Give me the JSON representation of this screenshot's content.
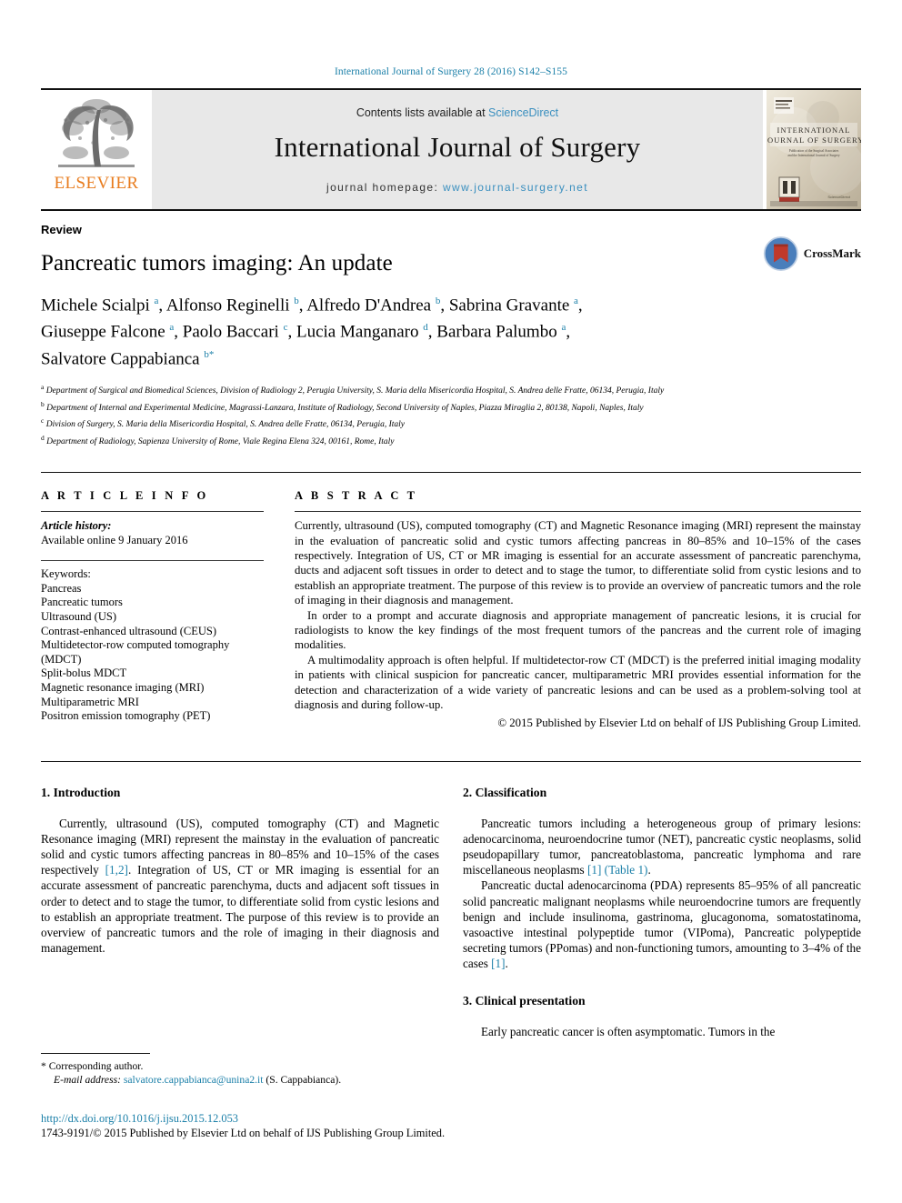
{
  "running_head": "International Journal of Surgery 28 (2016) S142–S155",
  "masthead": {
    "contents_prefix": "Contents lists available at ",
    "sciencedirect": "ScienceDirect",
    "journal_title": "International Journal of Surgery",
    "homepage_prefix": "journal homepage: ",
    "homepage_url": "www.journal-surgery.net",
    "publisher_name": "ELSEVIER",
    "cover_title_line1": "INTERNATIONAL",
    "cover_title_line2": "JOURNAL OF SURGERY"
  },
  "article": {
    "doctype": "Review",
    "title": "Pancreatic tumors imaging: An update",
    "authors_line1": "Michele Scialpi ",
    "authors_line1_sup1": "a",
    "authors_line1_b": ", Alfonso Reginelli ",
    "authors_line1_sup2": "b",
    "authors_line1_c": ", Alfredo D'Andrea ",
    "authors_line1_sup3": "b",
    "authors_line1_d": ", Sabrina Gravante ",
    "authors_line1_sup4": "a",
    "authors_line1_e": ",",
    "authors_line2_a": "Giuseppe Falcone ",
    "authors_line2_sup1": "a",
    "authors_line2_b": ", Paolo Baccari ",
    "authors_line2_sup2": "c",
    "authors_line2_c": ", Lucia Manganaro ",
    "authors_line2_sup3": "d",
    "authors_line2_d": ", Barbara Palumbo ",
    "authors_line2_sup4": "a",
    "authors_line2_e": ",",
    "authors_line3_a": "Salvatore Cappabianca ",
    "authors_line3_sup1": "b",
    "authors_line3_sup2": "*",
    "crossmark_label": "CrossMark",
    "affiliations": [
      {
        "marker": "a",
        "text": "Department of Surgical and Biomedical Sciences, Division of Radiology 2, Perugia University, S. Maria della Misericordia Hospital, S. Andrea delle Fratte, 06134, Perugia, Italy"
      },
      {
        "marker": "b",
        "text": "Department of Internal and Experimental Medicine, Magrassi-Lanzara, Institute of Radiology, Second University of Naples, Piazza Miraglia 2, 80138, Napoli, Naples, Italy"
      },
      {
        "marker": "c",
        "text": "Division of Surgery, S. Maria della Misericordia Hospital, S. Andrea delle Fratte, 06134, Perugia, Italy"
      },
      {
        "marker": "d",
        "text": "Department of Radiology, Sapienza University of Rome, Viale Regina Elena 324, 00161, Rome, Italy"
      }
    ]
  },
  "article_info": {
    "heading": "A R T I C L E   I N F O",
    "history_label": "Article history:",
    "history_value": "Available online 9 January 2016",
    "keywords_label": "Keywords:",
    "keywords": [
      "Pancreas",
      "Pancreatic tumors",
      "Ultrasound (US)",
      "Contrast-enhanced ultrasound (CEUS)",
      "Multidetector-row computed tomography (MDCT)",
      "Split-bolus MDCT",
      "Magnetic resonance imaging (MRI)",
      "Multiparametric MRI",
      "Positron emission tomography (PET)"
    ]
  },
  "abstract": {
    "heading": "A B S T R A C T",
    "paragraphs": [
      "Currently, ultrasound (US), computed tomography (CT) and Magnetic Resonance imaging (MRI) represent the mainstay in the evaluation of pancreatic solid and cystic tumors affecting pancreas in 80–85% and 10–15% of the cases respectively. Integration of US, CT or MR imaging is essential for an accurate assessment of pancreatic parenchyma, ducts and adjacent soft tissues in order to detect and to stage the tumor, to differentiate solid from cystic lesions and to establish an appropriate treatment. The purpose of this review is to provide an overview of pancreatic tumors and the role of imaging in their diagnosis and management.",
      "In order to a prompt and accurate diagnosis and appropriate management of pancreatic lesions, it is crucial for radiologists to know the key findings of the most frequent tumors of the pancreas and the current role of imaging modalities.",
      "A multimodality approach is often helpful. If multidetector-row CT (MDCT) is the preferred initial imaging modality in patients with clinical suspicion for pancreatic cancer, multiparametric MRI provides essential information for the detection and characterization of a wide variety of pancreatic lesions and can be used as a problem-solving tool at diagnosis and during follow-up."
    ],
    "copyright": "© 2015 Published by Elsevier Ltd on behalf of IJS Publishing Group Limited."
  },
  "sections": {
    "introduction": {
      "heading": "1. Introduction",
      "para1_a": "Currently, ultrasound (US), computed tomography (CT) and Magnetic Resonance imaging (MRI) represent the mainstay in the evaluation of pancreatic solid and cystic tumors affecting pancreas in 80–85% and 10–15% of the cases respectively ",
      "para1_ref": "[1,2]",
      "para1_b": ". Integration of US, CT or MR imaging is essential for an accurate assessment of pancreatic parenchyma, ducts and adjacent soft tissues in order to detect and to stage the tumor, to differentiate solid from cystic lesions and to establish an appropriate treatment. The purpose of this review is to provide an overview of pancreatic tumors and the role of imaging in their diagnosis and management."
    },
    "classification": {
      "heading": "2. Classification",
      "para1_a": "Pancreatic tumors including a heterogeneous group of primary lesions: adenocarcinoma, neuroendocrine tumor (NET), pancreatic cystic neoplasms, solid pseudopapillary tumor, pancreatoblastoma, pancreatic lymphoma and rare miscellaneous neoplasms ",
      "para1_ref1": "[1]",
      "para1_b": " ",
      "para1_ref2": "(Table 1)",
      "para1_c": ".",
      "para2_a": "Pancreatic ductal adenocarcinoma (PDA) represents 85–95% of all pancreatic solid pancreatic malignant neoplasms while neuroendocrine tumors are frequently benign and include insulinoma, gastrinoma, glucagonoma, somatostatinoma, vasoactive intestinal polypeptide tumor (VIPoma), Pancreatic polypeptide secreting tumors (PPomas) and non-functioning tumors, amounting to 3–4% of the cases ",
      "para2_ref": "[1]",
      "para2_b": "."
    },
    "clinical_presentation": {
      "heading": "3. Clinical presentation",
      "para1": "Early pancreatic cancer is often asymptomatic. Tumors in the"
    }
  },
  "footnote": {
    "star": "*",
    "corresponding": " Corresponding author.",
    "email_label": "E-mail address:",
    "email": "salvatore.cappabianca@unina2.it",
    "email_owner": " (S. Cappabianca)."
  },
  "footer": {
    "doi": "http://dx.doi.org/10.1016/j.ijsu.2015.12.053",
    "issn_line": "1743-9191/© 2015 Published by Elsevier Ltd on behalf of IJS Publishing Group Limited."
  },
  "colors": {
    "link_blue": "#1a7fa8",
    "elsevier_orange": "#e87c1e",
    "masthead_grey": "#e8e8e8",
    "crossmark_red": "#c0392b",
    "crossmark_blue": "#4a7ebb"
  }
}
